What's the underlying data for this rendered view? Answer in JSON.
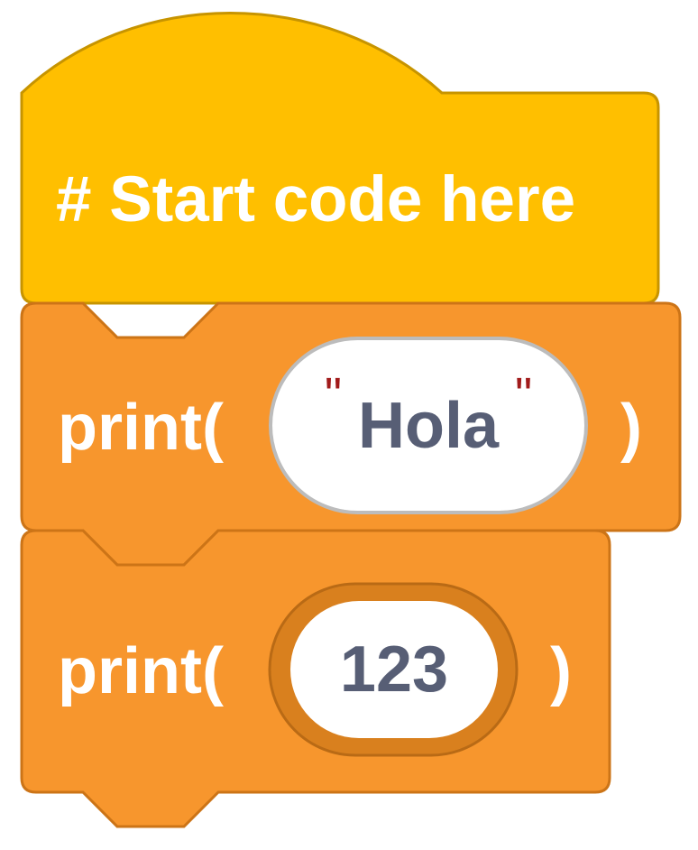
{
  "blocks": {
    "hat": {
      "text": "# Start code here",
      "color": "#ffbf00",
      "stroke": "#c79400"
    },
    "print1": {
      "label": "print(",
      "close": ")",
      "arg": {
        "open_quote": "\"",
        "value": "Hola",
        "close_quote": "\""
      },
      "color": "#f7962d",
      "stroke": "#cc7417"
    },
    "print2": {
      "label": "print(",
      "close": ")",
      "arg": {
        "value": "123"
      },
      "color": "#f7962d",
      "stroke": "#cc7417",
      "slot_color": "#d9801e"
    }
  },
  "colors": {
    "text": "#ffffff",
    "value_text": "#575e75",
    "quote": "#a11b1b",
    "input_bg": "#ffffff",
    "input_stroke": "#bcbcbc"
  }
}
